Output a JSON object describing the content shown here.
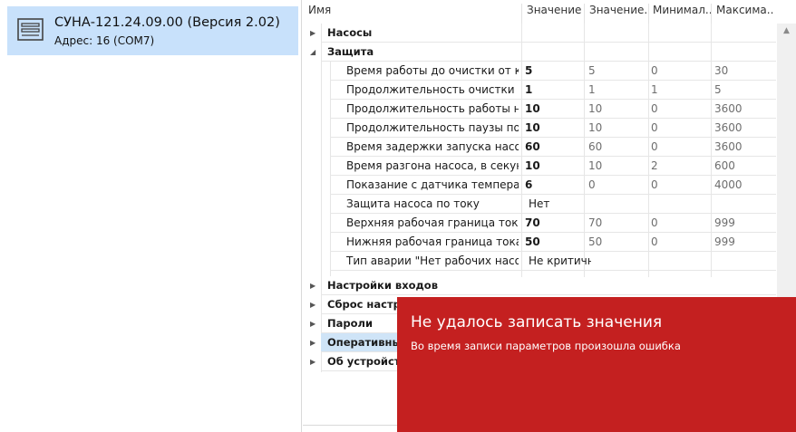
{
  "device": {
    "title": "СУНА-121.24.09.00 (Версия 2.02)",
    "address": "Адрес: 16 (COM7)"
  },
  "grid": {
    "columns": [
      "Имя",
      "Значение",
      "Значение...",
      "Минимал...",
      "Максима..."
    ],
    "groups_top": [
      {
        "label": "Насосы",
        "expanded": false
      },
      {
        "label": "Защита",
        "expanded": true
      }
    ],
    "rows": [
      {
        "name": "Время работы до очистки от кир...",
        "value": "5",
        "default": "5",
        "min": "0",
        "max": "30"
      },
      {
        "name": "Продолжительность очистки от к...",
        "value": "1",
        "default": "1",
        "min": "1",
        "max": "5"
      },
      {
        "name": "Продолжительность  работы нас...",
        "value": "10",
        "default": "10",
        "min": "0",
        "max": "3600"
      },
      {
        "name": "Продолжительность паузы по ав...",
        "value": "10",
        "default": "10",
        "min": "0",
        "max": "3600"
      },
      {
        "name": "Время задержки запуска насоса...",
        "value": "60",
        "default": "60",
        "min": "0",
        "max": "3600"
      },
      {
        "name": "Время разгона насоса, в секундах",
        "value": "10",
        "default": "10",
        "min": "2",
        "max": "600"
      },
      {
        "name": "Показание с датчика температур...",
        "value": "6",
        "default": "0",
        "min": "0",
        "max": "4000"
      },
      {
        "name": "Защита насоса по току",
        "value": "Нет",
        "default": "",
        "min": "",
        "max": ""
      },
      {
        "name": "Верхняя рабочая граница тока на...",
        "value": "70",
        "default": "70",
        "min": "0",
        "max": "999"
      },
      {
        "name": "Нижняя рабочая граница тока на...",
        "value": "50",
        "default": "50",
        "min": "0",
        "max": "999"
      },
      {
        "name": "Тип аварии \"Нет рабочих насосов\"",
        "value": "Не критична",
        "default": "",
        "min": "",
        "max": ""
      }
    ],
    "groups_bottom": [
      {
        "label": "Настройки входов"
      },
      {
        "label": "Сброс настроек"
      },
      {
        "label": "Пароли"
      },
      {
        "label": "Оперативные"
      },
      {
        "label": "Об устройстве"
      }
    ]
  },
  "toast": {
    "title": "Не удалось записать значения",
    "message": "Во время записи параметров произошла ошибка",
    "color": "#c42020"
  },
  "colors": {
    "selection": "#c8e1fb",
    "row_highlight": "#cfe4f7"
  },
  "icons": {
    "device": "device-icon",
    "collapsed": "chevron-right-icon",
    "expanded": "chevron-down-icon",
    "scroll_up": "scroll-up-arrow-icon"
  }
}
